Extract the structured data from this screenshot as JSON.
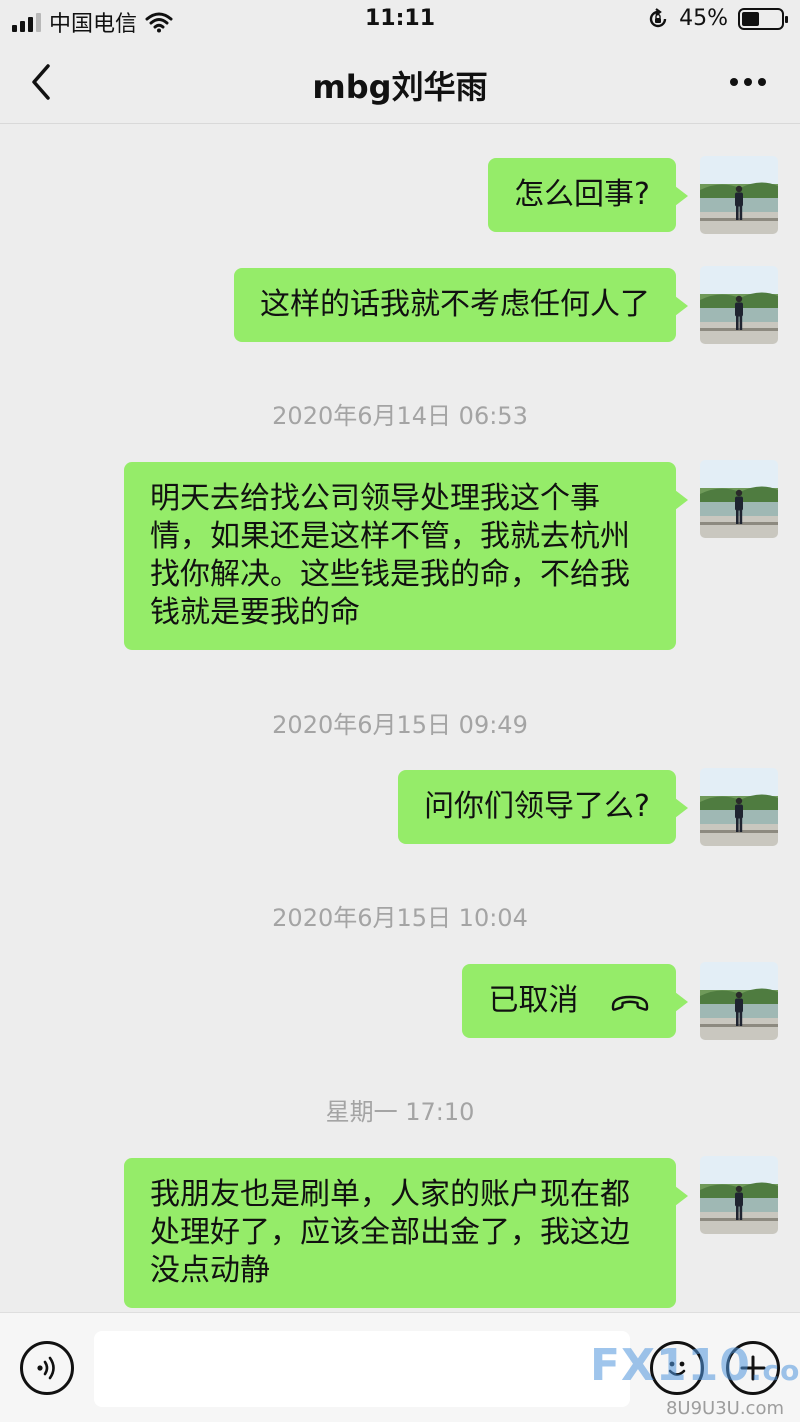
{
  "status_bar": {
    "carrier": "中国电信",
    "time": "11:11",
    "battery_percent": "45%",
    "battery_level": 0.45
  },
  "header": {
    "title": "mbg刘华雨",
    "back_icon": "chevron-left-icon",
    "more_icon": "more-dots-icon"
  },
  "messages": [
    {
      "type": "text",
      "text": "怎么回事?"
    },
    {
      "type": "text",
      "text": "这样的话我就不考虑任何人了"
    },
    {
      "type": "timestamp",
      "text": "2020年6月14日 06:53"
    },
    {
      "type": "text",
      "lines": [
        "明天去给找公司领导处理我这个事",
        "情，如果还是这样不管，我就去杭州",
        "找你解决。这些钱是我的命，不给我",
        "钱就是要我的命"
      ]
    },
    {
      "type": "timestamp",
      "text": "2020年6月15日 09:49"
    },
    {
      "type": "text",
      "text": "问你们领导了么?"
    },
    {
      "type": "timestamp",
      "text": "2020年6月15日 10:04"
    },
    {
      "type": "call",
      "text": "已取消",
      "icon": "phone-hangup-icon"
    },
    {
      "type": "timestamp",
      "text": "星期一 17:10"
    },
    {
      "type": "text",
      "lines": [
        "我朋友也是刷单，人家的账户现在都",
        "处理好了，应该全部出金了，我这边",
        "没点动静"
      ]
    }
  ],
  "input_bar": {
    "voice_icon": "voice-icon",
    "emoji_icon": "emoji-icon",
    "add_icon": "plus-icon"
  },
  "watermark": {
    "brand": "FX110",
    "domain": ".com",
    "sub": "8U9U3U.com"
  },
  "colors": {
    "background": "#ededed",
    "bubble": "#95ec69",
    "timestamp": "#a4a4a4"
  }
}
